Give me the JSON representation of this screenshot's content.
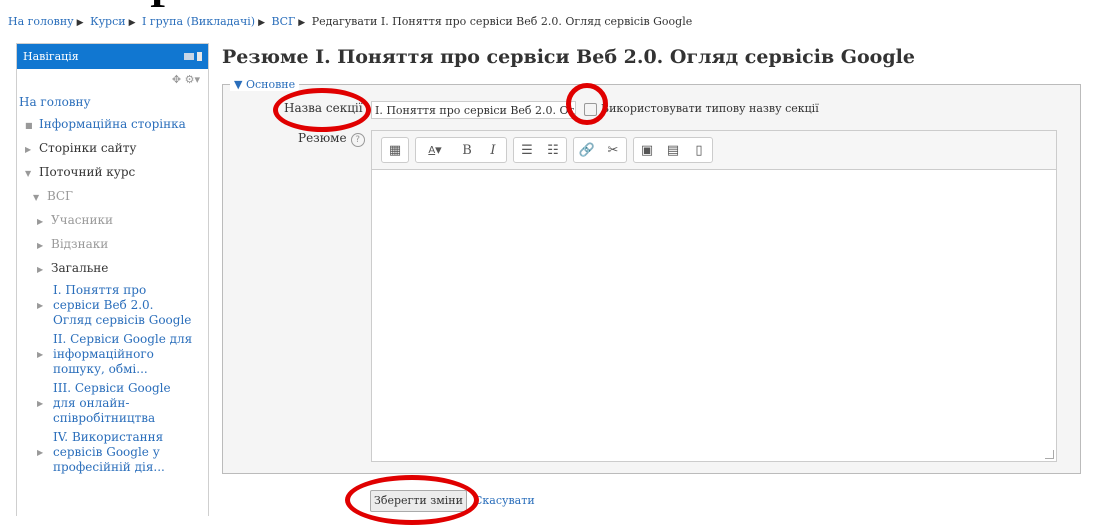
{
  "breadcrumb": {
    "items": [
      "На головну",
      "Курси",
      "І група (Викладачі)",
      "ВСГ",
      "Редагувати І. Поняття про сервіси Веб 2.0. Огляд сервісів Google"
    ]
  },
  "sidebar": {
    "title": "Навігація",
    "home": "На головну",
    "items": [
      "Інформаційна сторінка",
      "Сторінки сайту",
      "Поточний курс",
      "ВСГ",
      "Учасники",
      "Відзнаки",
      "Загальне",
      "І. Поняття про сервіси Веб 2.0. Огляд сервісів Google",
      "ІІ. Сервіси Google для інформаційного пошуку, обмі...",
      "ІІІ. Сервіси Google для онлайн-співробітництва",
      "IV. Використання сервісів Google у професійній дія..."
    ]
  },
  "main": {
    "title": "Резюме І. Поняття про сервіси Веб 2.0. Огляд сервісів Google",
    "legend": "Основне",
    "section_name_label": "Назва секції",
    "section_name_value": "І. Поняття про сервіси Веб 2.0. Огл",
    "use_default_label": "Використовувати типову назву секції",
    "use_default_checked": false,
    "summary_label": "Резюме",
    "save_label": "Зберегти зміни",
    "cancel_label": "Скасувати"
  },
  "colors": {
    "nav_header": "#1177d1",
    "link": "#2a6ebb",
    "annotation_ring": "#e00000"
  }
}
